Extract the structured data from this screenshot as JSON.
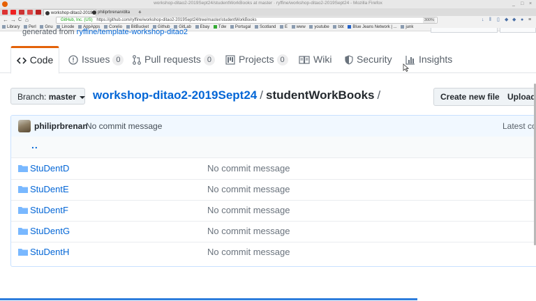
{
  "window": {
    "title": "workshop-ditao2-2019Sept24/studentWorkBooks at master · ryffine/workshop-ditao2-2019Sept24 - Mozilla Firefox",
    "controls": [
      "_",
      "□",
      "×"
    ]
  },
  "tabs": [
    {
      "label": "workshop-ditao2-2019",
      "close": "×"
    },
    {
      "label": "philiprbrenan/dita",
      "close": "×"
    }
  ],
  "new_tab": "+",
  "nav": {
    "back": "←",
    "forward": "→",
    "reload": "C",
    "home": "⌂",
    "secure_label": "GitHub, Inc. (US)",
    "url": "https://github.com/ryffine/workshop-ditao2-2019Sept24/tree/master/studentWorkBooks",
    "zoom": "300%"
  },
  "bookmarks": [
    "Library",
    "Perl",
    "Gnu",
    "Linode",
    "AppApps",
    "Corelio",
    "BitBucket",
    "Github",
    "GitLab",
    "Ebay",
    "Tdw",
    "Portugal",
    "Scotland",
    "E",
    "www",
    "youtube",
    "bbt",
    "Blue Jeans Network | ...",
    "junk"
  ],
  "repo": {
    "generated_prefix": "generated from",
    "generated_link": "ryffine/template-workshop-ditao2"
  },
  "reponav": [
    {
      "label": "Code",
      "icon": "code-icon",
      "counter": null
    },
    {
      "label": "Issues",
      "icon": "issue-icon",
      "counter": "0"
    },
    {
      "label": "Pull requests",
      "icon": "pull-request-icon",
      "counter": "0"
    },
    {
      "label": "Projects",
      "icon": "project-icon",
      "counter": "0"
    },
    {
      "label": "Wiki",
      "icon": "book-icon",
      "counter": null
    },
    {
      "label": "Security",
      "icon": "shield-icon",
      "counter": null
    },
    {
      "label": "Insights",
      "icon": "graph-icon",
      "counter": null
    }
  ],
  "branch": {
    "prefix": "Branch:",
    "name": "master"
  },
  "breadcrumb": {
    "root": "workshop-ditao2-2019Sept24",
    "sep": "/",
    "current": "studentWorkBooks",
    "trail": "/"
  },
  "buttons": {
    "create_new_file": "Create new file",
    "upload": "Upload"
  },
  "commit": {
    "author": "philiprbrenan",
    "message": "No commit message",
    "latest": "Latest co"
  },
  "up_dir": "..",
  "files": [
    {
      "name": "StuDentD",
      "message": "No commit message"
    },
    {
      "name": "StuDentE",
      "message": "No commit message"
    },
    {
      "name": "StuDentF",
      "message": "No commit message"
    },
    {
      "name": "StuDentG",
      "message": "No commit message"
    },
    {
      "name": "StuDentH",
      "message": "No commit message"
    }
  ],
  "colors": {
    "link": "#0366d6",
    "selected_tab_accent": "#e36209",
    "commit_bar": "#f1f8ff",
    "folder": "#79b8ff"
  }
}
